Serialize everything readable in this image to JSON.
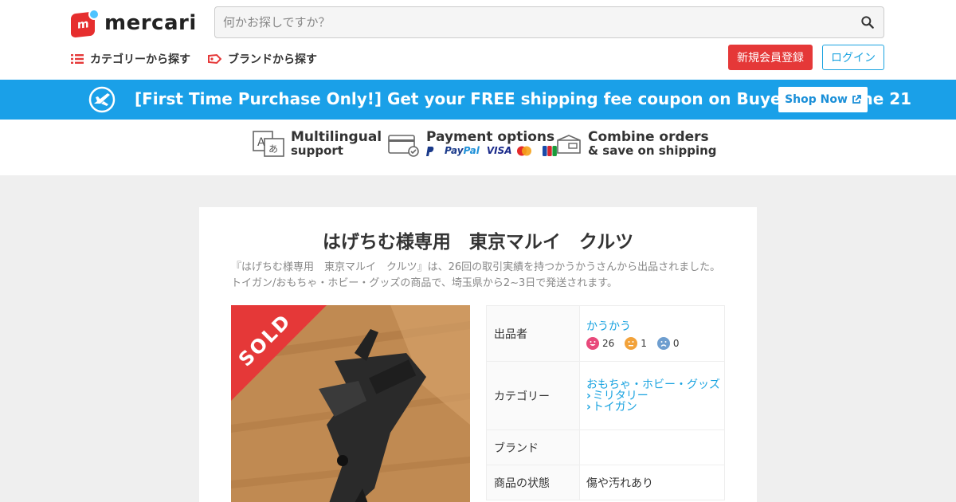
{
  "header": {
    "logo_text": "mercari",
    "logo_mark": "m",
    "search_placeholder": "何かお探しですか？",
    "nav_category": "カテゴリーから探す",
    "nav_brand": "ブランドから探す",
    "register_label": "新規会員登録",
    "login_label": "ログイン"
  },
  "banner": {
    "text": "[First Time Purchase Only!] Get your FREE shipping fee coupon on Buyee until June 21",
    "shop_label": "Shop Now"
  },
  "features": [
    {
      "line1": "Multilingual",
      "line2": "support",
      "icon": "translate-icon"
    },
    {
      "line1": "Payment options",
      "line2": "",
      "icon": "card-icon",
      "logos": [
        "PayPal",
        "VISA",
        "Mastercard",
        "JCB"
      ]
    },
    {
      "line1": "Combine orders",
      "line2": "& save on shipping",
      "icon": "box-icon"
    }
  ],
  "pay": {
    "pp1": "Pay",
    "pp2": "Pal",
    "visa": "VISA"
  },
  "item": {
    "title": "はげちむ様専用　東京マルイ　クルツ",
    "description": "『はげちむ様専用　東京マルイ　クルツ』は、26回の取引実績を持つかうかうさんから出品されました。トイガン/おもちゃ・ホビー・グッズの商品で、埼玉県から2~3日で発送されます。",
    "sold_label": "SOLD"
  },
  "details": {
    "seller_key": "出品者",
    "seller_name": "かうかう",
    "ratings": {
      "good": "26",
      "normal": "1",
      "bad": "0"
    },
    "category_key": "カテゴリー",
    "category_top": "おもちゃ・ホビー・グッズ",
    "category_mid": "ミリタリー",
    "category_leaf": "トイガン",
    "brand_key": "ブランド",
    "brand_value": "",
    "condition_key": "商品の状態",
    "condition_value": "傷や汚れあり"
  },
  "colors": {
    "brand_red": "#e62e2e",
    "accent_blue": "#1aa3e0",
    "banner_blue": "#1aa0e8",
    "good_face": "#e8497b",
    "normal_face": "#f2a23a",
    "bad_face": "#6e9ecf"
  }
}
